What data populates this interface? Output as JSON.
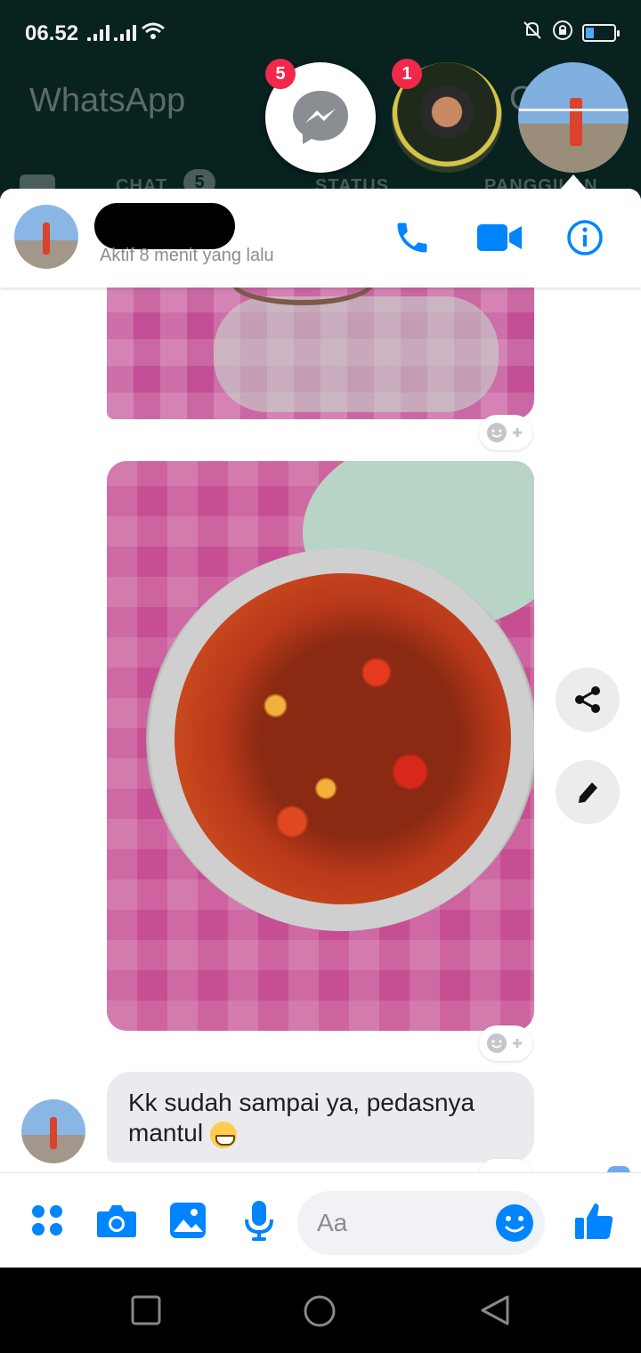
{
  "status_bar": {
    "time": "06.52",
    "battery_level": 0.2
  },
  "background_app": {
    "title": "WhatsApp",
    "tabs": [
      "CHAT",
      "STATUS",
      "PANGGILAN"
    ],
    "chat_badge": "5",
    "partial_char": "C"
  },
  "chat_heads": [
    {
      "name": "messenger-head",
      "badge": "5"
    },
    {
      "name": "contact-head-1",
      "badge": "1"
    },
    {
      "name": "contact-head-2",
      "badge": ""
    }
  ],
  "chat_header": {
    "active_status": "Aktif 8 menit yang lalu",
    "icons": [
      "phone-icon",
      "video-camera-icon",
      "info-icon"
    ]
  },
  "messages": [
    {
      "type": "image",
      "description_icon": "photo"
    },
    {
      "type": "image",
      "description_icon": "photo"
    },
    {
      "type": "text",
      "text": "Kk sudah sampai ya, pedasnya mantul"
    }
  ],
  "composer": {
    "placeholder": "Aa",
    "icons": [
      "menu-dots-icon",
      "camera-icon",
      "gallery-icon",
      "microphone-icon",
      "emoji-icon",
      "thumbs-up-icon"
    ]
  },
  "side_actions": [
    "share-icon",
    "edit-icon"
  ],
  "colors": {
    "messenger_blue": "#0084ff",
    "badge_red": "#f02849",
    "bubble_gray": "#e9ebee",
    "wa_dark": "#07221f"
  }
}
